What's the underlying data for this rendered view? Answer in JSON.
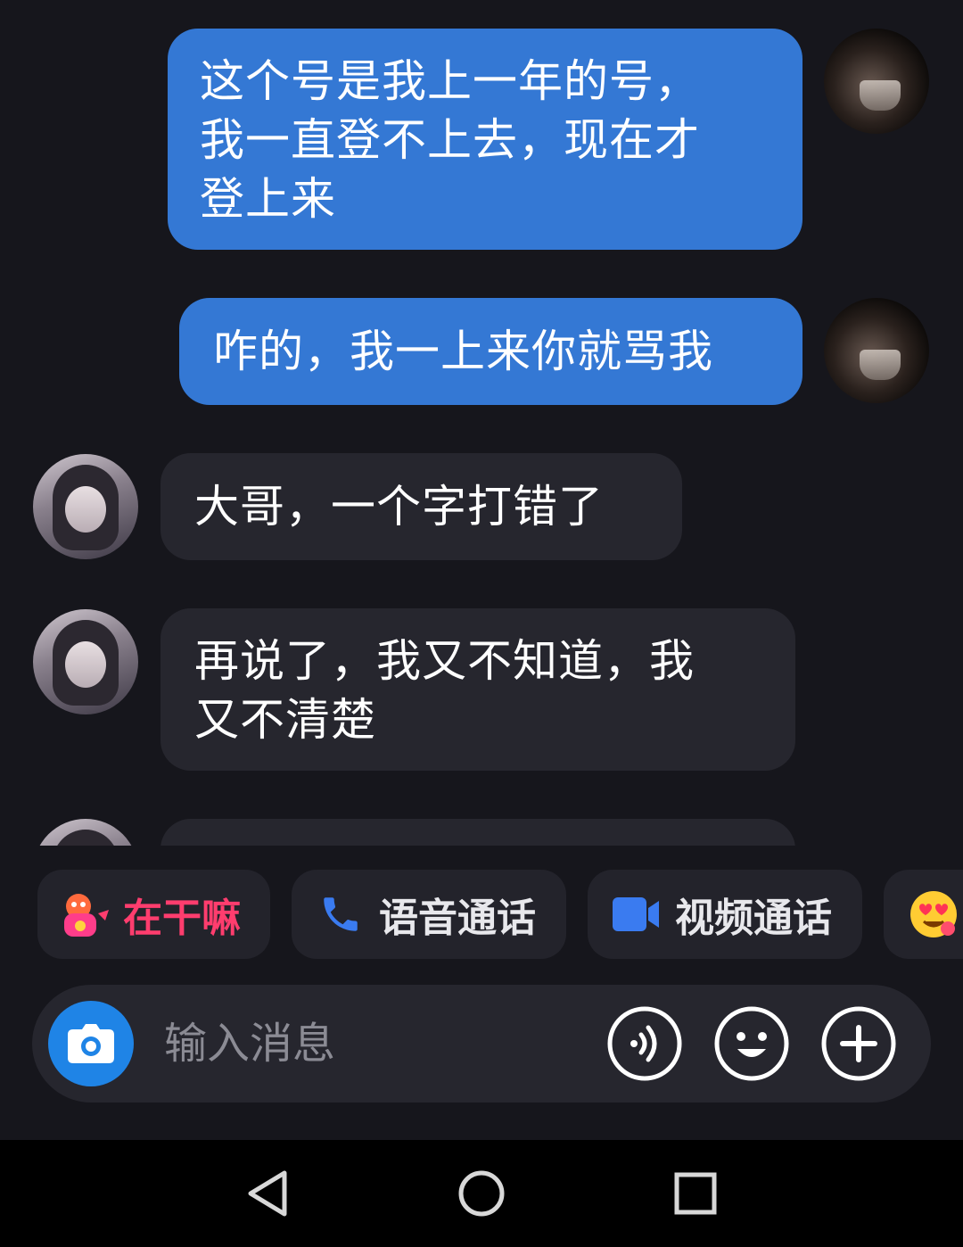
{
  "messages": [
    {
      "side": "out",
      "lines": [
        "这个号是我上一年的号，",
        "我一直登不上去，现在才",
        "登上来"
      ]
    },
    {
      "side": "out",
      "lines": [
        "咋的，我一上来你就骂我"
      ]
    },
    {
      "side": "in",
      "lines": [
        "大哥，一个字打错了"
      ]
    },
    {
      "side": "in",
      "lines": [
        "再说了，我又不知道，我",
        "又不清楚"
      ]
    }
  ],
  "quick_actions": [
    {
      "label": "在干嘛",
      "icon": "emoji-sticker-icon",
      "color": "#ff3d6e"
    },
    {
      "label": "语音通话",
      "icon": "phone-icon",
      "color": "#3a7bf0"
    },
    {
      "label": "视频通话",
      "icon": "video-camera-icon",
      "color": "#3a7bf0"
    },
    {
      "label": "",
      "icon": "heart-eyes-emoji-icon"
    }
  ],
  "composer": {
    "placeholder": "输入消息",
    "camera_icon": "camera-icon",
    "voice_icon": "voice-icon",
    "emoji_icon": "smiley-icon",
    "plus_icon": "plus-icon"
  },
  "colors": {
    "background": "#16161c",
    "outgoing_bubble": "#3478d4",
    "incoming_bubble": "#26262e",
    "accent": "#1f84e6"
  }
}
